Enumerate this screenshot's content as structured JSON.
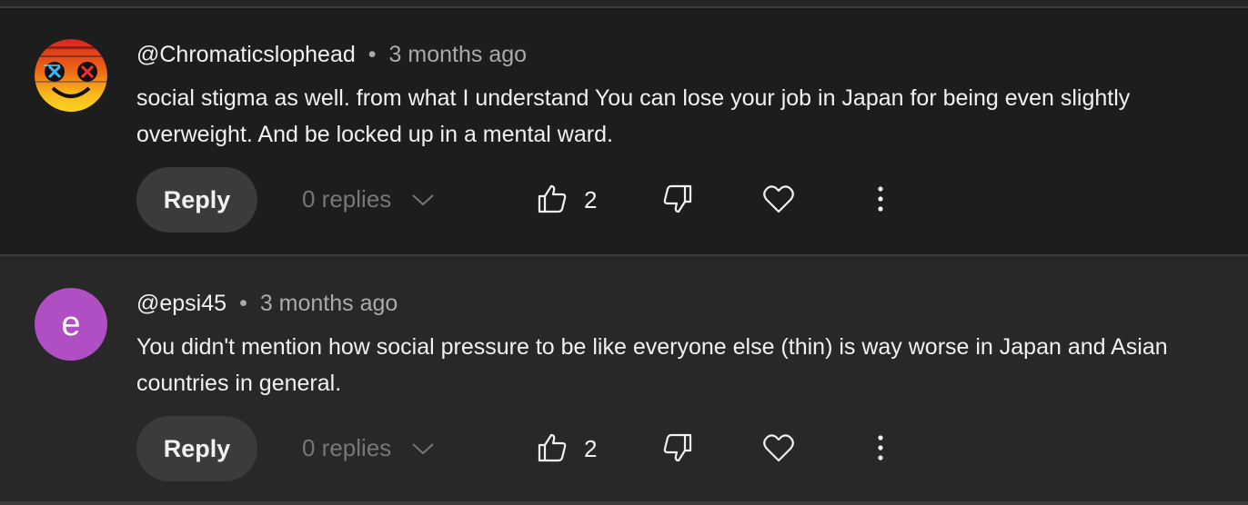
{
  "comments": [
    {
      "author": "@Chromaticslophead",
      "separator": "•",
      "time": "3 months ago",
      "text": "social stigma as well.  from what I understand You can lose your job in Japan for being even slightly overweight. And be locked up in a mental ward.",
      "reply_label": "Reply",
      "replies_label": "0 replies",
      "like_count": "2",
      "avatar": {
        "type": "image",
        "icon": "glitch-smiley-avatar"
      }
    },
    {
      "author": "@epsi45",
      "separator": "•",
      "time": "3 months ago",
      "text": "You didn't mention how social pressure to be like everyone else (thin) is way worse in Japan and Asian countries in general.",
      "reply_label": "Reply",
      "replies_label": "0 replies",
      "like_count": "2",
      "avatar": {
        "type": "letter",
        "letter": "e",
        "color": "#b04fc4"
      }
    }
  ],
  "colors": {
    "background_top": "#1d1d1d",
    "background_bottom": "#282828",
    "text": "#f1f1f1",
    "secondary_text": "#aaaaaa",
    "button": "#3b3b3b"
  }
}
